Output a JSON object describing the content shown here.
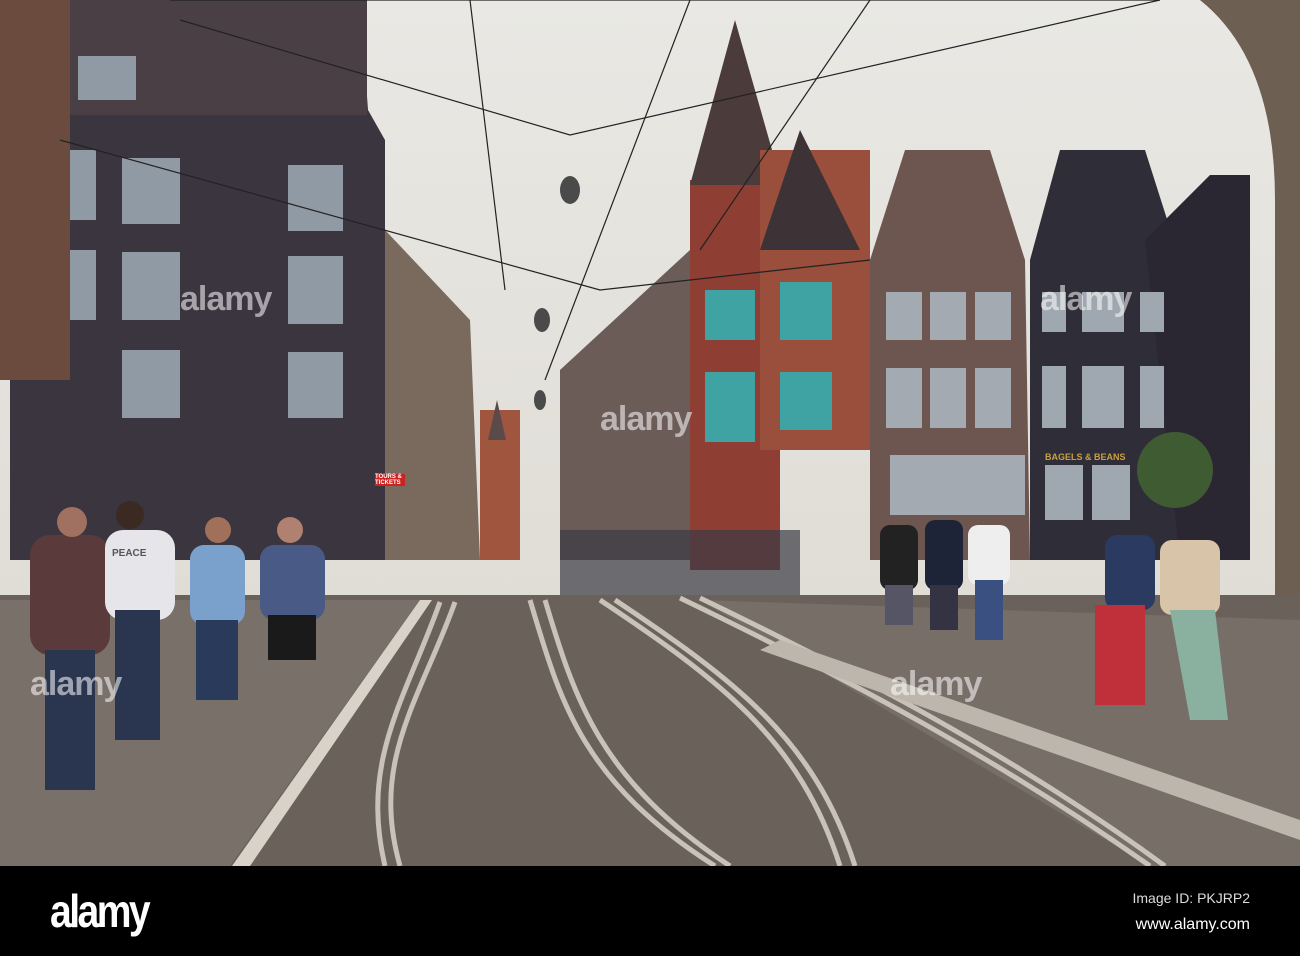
{
  "scene": {
    "shop_sign": "BAGELS & BEANS",
    "tours_sign": "TOURS & TICKETS",
    "shirt_text": "PEACE"
  },
  "watermark": {
    "text": "alamy"
  },
  "footer": {
    "logo": "alamy",
    "image_id": "Image ID: PKJRP2",
    "website": "www.alamy.com"
  },
  "colors": {
    "sky": "#e9e8e4",
    "street": "#6a615b",
    "brick": "#8a4a3a",
    "dark_facade": "#3a3540"
  }
}
